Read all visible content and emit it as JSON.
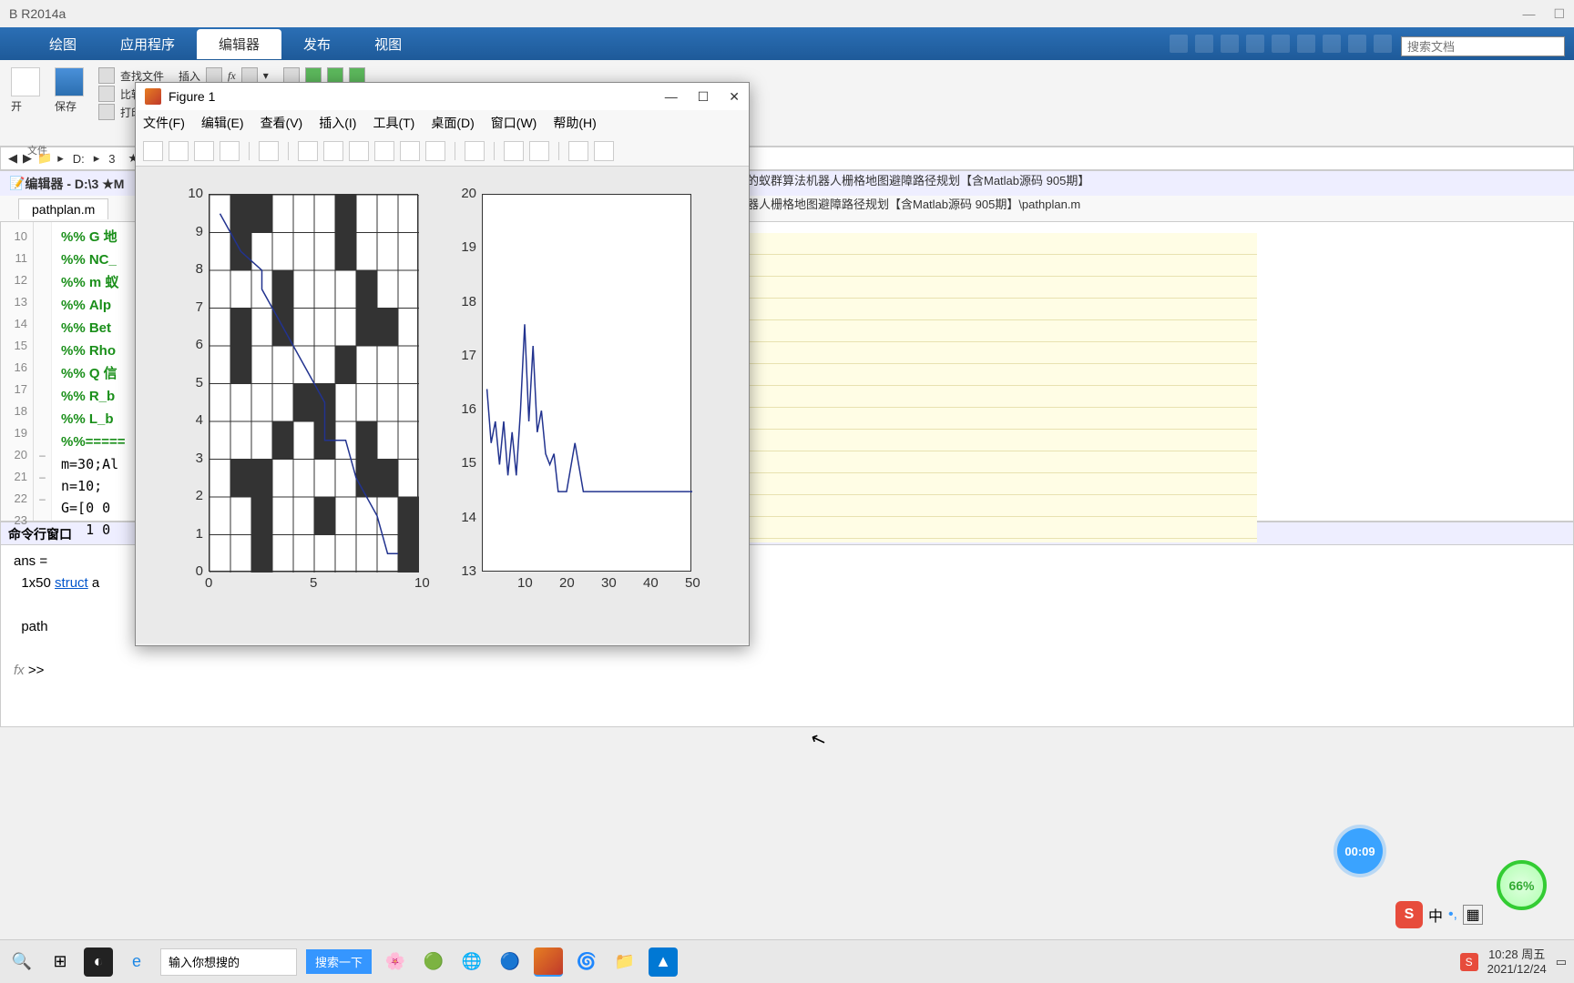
{
  "app_title": "B R2014a",
  "tabs": {
    "t1": "绘图",
    "t2": "应用程序",
    "t3": "编辑器",
    "t4": "发布",
    "t5": "视图"
  },
  "search_placeholder": "搜索文档",
  "toolstrip": {
    "open": "开",
    "save": "保存",
    "section_file": "文件",
    "find": "查找文件",
    "compare": "比较",
    "print": "打印",
    "insert": "插入",
    "fx": "fx"
  },
  "addr": {
    "d": "D:",
    "n3": "3",
    "star": "★M"
  },
  "path_long1": "的蚁群算法机器人栅格地图避障路径规划【含Matlab源码 905期】",
  "path_long2": "器人栅格地图避障路径规划【含Matlab源码 905期】\\pathplan.m",
  "editor_title": "编辑器 - D:\\3 ★M",
  "file_tab": "pathplan.m",
  "gutter": [
    "10",
    "11",
    "12",
    "13",
    "14",
    "15",
    "16",
    "17",
    "18",
    "19",
    "20",
    "21",
    "22",
    "23"
  ],
  "foldmarks": [
    "",
    "",
    "",
    "",
    "",
    "",
    "",
    "",
    "",
    "",
    "–",
    "–",
    "–",
    ""
  ],
  "code_lines": [
    "%% G 地",
    "%% NC_",
    "%% m 蚁",
    "%% Alp",
    "%% Bet",
    "%% Rho",
    "%% Q 信",
    "%% R_b",
    "%% L_b",
    "%%=====",
    "m=30;Al",
    "n=10;",
    "G=[0 0",
    "   1 0"
  ],
  "cmd_title": "命令行窗口",
  "cmd": {
    "l1": "ans =",
    "l2_pre": "1x50 ",
    "l2_link": "struct",
    "l2_post": " a",
    "l3": "path",
    "prompt": ">>"
  },
  "fx": "fx",
  "figure": {
    "title": "Figure 1",
    "menus": [
      "文件(F)",
      "编辑(E)",
      "查看(V)",
      "插入(I)",
      "工具(T)",
      "桌面(D)",
      "窗口(W)",
      "帮助(H)"
    ],
    "min": "—",
    "max": "☐",
    "close": "✕"
  },
  "chart_data": [
    {
      "type": "grid-path",
      "xlim": [
        0,
        10
      ],
      "ylim": [
        0,
        10
      ],
      "xticks": [
        0,
        5,
        10
      ],
      "yticks": [
        0,
        1,
        2,
        3,
        4,
        5,
        6,
        7,
        8,
        9,
        10
      ],
      "obstacle_cells": [
        [
          1,
          9
        ],
        [
          2,
          9
        ],
        [
          6,
          9
        ],
        [
          1,
          8
        ],
        [
          6,
          8
        ],
        [
          3,
          7
        ],
        [
          7,
          7
        ],
        [
          1,
          6
        ],
        [
          3,
          6
        ],
        [
          7,
          6
        ],
        [
          8,
          6
        ],
        [
          1,
          5
        ],
        [
          6,
          5
        ],
        [
          4,
          4
        ],
        [
          5,
          4
        ],
        [
          3,
          3
        ],
        [
          5,
          3
        ],
        [
          7,
          3
        ],
        [
          1,
          2
        ],
        [
          2,
          2
        ],
        [
          7,
          2
        ],
        [
          8,
          2
        ],
        [
          2,
          1
        ],
        [
          5,
          1
        ],
        [
          9,
          1
        ],
        [
          2,
          0
        ],
        [
          9,
          0
        ]
      ],
      "path_points": [
        [
          0.5,
          9.5
        ],
        [
          1.5,
          8.5
        ],
        [
          2.5,
          8
        ],
        [
          2.5,
          7.5
        ],
        [
          3,
          7
        ],
        [
          3.5,
          6.5
        ],
        [
          4,
          6
        ],
        [
          4.5,
          5.5
        ],
        [
          5,
          5
        ],
        [
          5.5,
          4.5
        ],
        [
          5.5,
          3.5
        ],
        [
          6.5,
          3.5
        ],
        [
          7,
          2.5
        ],
        [
          8,
          1.5
        ],
        [
          8.5,
          0.5
        ],
        [
          9,
          0.5
        ]
      ]
    },
    {
      "type": "line",
      "xlim": [
        0,
        50
      ],
      "ylim": [
        13,
        20
      ],
      "xticks": [
        10,
        20,
        30,
        40,
        50
      ],
      "yticks": [
        13,
        14,
        15,
        16,
        17,
        18,
        19,
        20
      ],
      "x": [
        1,
        2,
        3,
        4,
        5,
        6,
        7,
        8,
        9,
        10,
        11,
        12,
        13,
        14,
        15,
        16,
        17,
        18,
        20,
        22,
        24,
        25,
        30,
        35,
        40,
        45,
        50
      ],
      "y": [
        16.4,
        15.4,
        15.8,
        15.0,
        15.8,
        14.8,
        15.6,
        14.8,
        16.0,
        17.6,
        15.8,
        17.2,
        15.6,
        16.0,
        15.2,
        15.0,
        15.2,
        14.5,
        14.5,
        15.4,
        14.5,
        14.5,
        14.5,
        14.5,
        14.5,
        14.5,
        14.5
      ]
    }
  ],
  "taskbar": {
    "search_ph": "输入你想搜的",
    "search_btn": "搜索一下",
    "time": "10:28",
    "day": "周五",
    "date": "2021/12/24"
  },
  "badges": {
    "timer": "00:09",
    "pct": "66%",
    "ime": "中"
  },
  "sogou": "S"
}
